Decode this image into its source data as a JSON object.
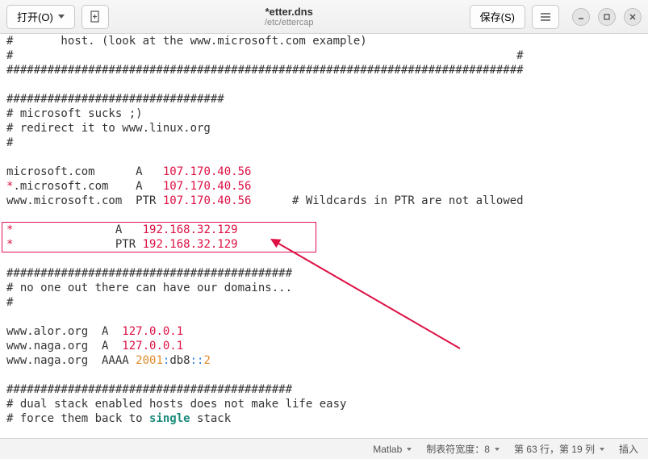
{
  "titlebar": {
    "open_label": "打开(O)",
    "save_label": "保存(S)",
    "title": "*etter.dns",
    "subtitle": "/etc/ettercap"
  },
  "editor": {
    "lines": [
      [
        {
          "t": "#       host. (look at the www.microsoft.com example)",
          "c": "dark"
        }
      ],
      [
        {
          "t": "#                                                                          #",
          "c": "dark"
        }
      ],
      [
        {
          "t": "############################################################################",
          "c": "dark"
        }
      ],
      [
        {
          "t": "",
          "c": "dark"
        }
      ],
      [
        {
          "t": "################################",
          "c": "dark"
        }
      ],
      [
        {
          "t": "# microsoft sucks ;)",
          "c": "dark"
        }
      ],
      [
        {
          "t": "# redirect it to www.linux.org",
          "c": "dark"
        }
      ],
      [
        {
          "t": "#",
          "c": "dark"
        }
      ],
      [
        {
          "t": "",
          "c": "dark"
        }
      ],
      [
        {
          "t": "microsoft.com      A   ",
          "c": "dark"
        },
        {
          "t": "107.170.40.56",
          "c": "red"
        }
      ],
      [
        {
          "t": "*",
          "c": "red"
        },
        {
          "t": ".microsoft.com    A   ",
          "c": "dark"
        },
        {
          "t": "107.170.40.56",
          "c": "red"
        }
      ],
      [
        {
          "t": "www.microsoft.com  PTR ",
          "c": "dark"
        },
        {
          "t": "107.170.40.56",
          "c": "red"
        },
        {
          "t": "      # Wildcards in PTR are not allowed",
          "c": "dark"
        }
      ],
      [
        {
          "t": "",
          "c": "dark"
        }
      ],
      [
        {
          "t": "*",
          "c": "red"
        },
        {
          "t": "               A   ",
          "c": "dark"
        },
        {
          "t": "192.168.32.129",
          "c": "red"
        }
      ],
      [
        {
          "t": "*",
          "c": "red"
        },
        {
          "t": "               PTR ",
          "c": "dark"
        },
        {
          "t": "192.168.32.129",
          "c": "red"
        }
      ],
      [
        {
          "t": "",
          "c": "dark"
        }
      ],
      [
        {
          "t": "##########################################",
          "c": "dark"
        }
      ],
      [
        {
          "t": "# no one out there can have our domains...",
          "c": "dark"
        }
      ],
      [
        {
          "t": "#",
          "c": "dark"
        }
      ],
      [
        {
          "t": "",
          "c": "dark"
        }
      ],
      [
        {
          "t": "www.alor.org  A  ",
          "c": "dark"
        },
        {
          "t": "127.0.0.1",
          "c": "red"
        }
      ],
      [
        {
          "t": "www.naga.org  A  ",
          "c": "dark"
        },
        {
          "t": "127.0.0.1",
          "c": "red"
        }
      ],
      [
        {
          "t": "www.naga.org  AAAA ",
          "c": "dark"
        },
        {
          "t": "2001",
          "c": "orange"
        },
        {
          "t": ":",
          "c": "blue"
        },
        {
          "t": "db8",
          "c": "dark"
        },
        {
          "t": "::",
          "c": "blue"
        },
        {
          "t": "2",
          "c": "orange"
        }
      ],
      [
        {
          "t": "",
          "c": "dark"
        }
      ],
      [
        {
          "t": "##########################################",
          "c": "dark"
        }
      ],
      [
        {
          "t": "# dual stack enabled hosts does not make life easy",
          "c": "dark"
        }
      ],
      [
        {
          "t": "# force them back to ",
          "c": "dark"
        },
        {
          "t": "single",
          "c": "teal"
        },
        {
          "t": " stack",
          "c": "dark"
        }
      ]
    ]
  },
  "statusbar": {
    "lang": "Matlab",
    "tabwidth": "制表符宽度：8",
    "position": "第 63 行，第 19 列",
    "mode": "插入"
  }
}
